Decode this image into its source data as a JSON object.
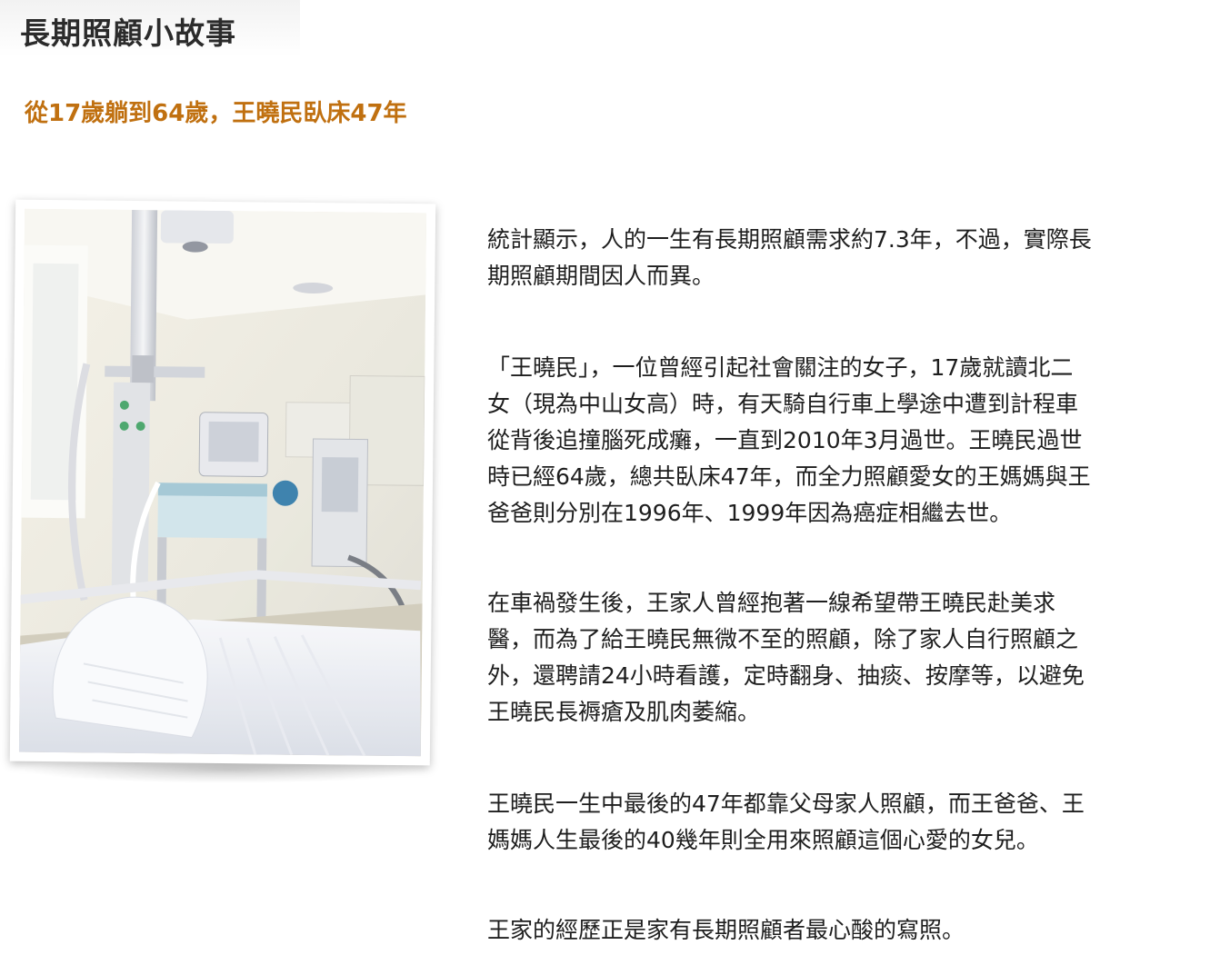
{
  "header": {
    "title": "長期照顧小故事"
  },
  "article": {
    "subtitle": "從17歲躺到64歲，王曉民臥床47年",
    "paragraphs": [
      [
        "統計顯示，人的一生有長期照顧需求約7.3年，不過，實際長",
        "期照顧期間因人而異。"
      ],
      [
        "「王曉民」，一位曾經引起社會關注的女子，17歲就讀北二",
        "女（現為中山女高）時，有天騎自行車上學途中遭到計程車",
        "從背後追撞腦死成癱，一直到2010年3月過世。王曉民過世",
        "時已經64歲，總共臥床47年，而全力照顧愛女的王媽媽與王",
        "爸爸則分別在1996年、1999年因為癌症相繼去世。"
      ],
      [
        "在車禍發生後，王家人曾經抱著一線希望帶王曉民赴美求",
        "醫，而為了給王曉民無微不至的照顧，除了家人自行照顧之",
        "外，還聘請24小時看護，定時翻身、抽痰、按摩等，以避免",
        "王曉民長褥瘡及肌肉萎縮。"
      ],
      [
        "王曉民一生中最後的47年都靠父母家人照顧，而王爸爸、王",
        "媽媽人生最後的40幾年則全用來照顧這個心愛的女兒。"
      ],
      [
        "王家的經歷正是家有長期照顧者最心酸的寫照。"
      ]
    ]
  },
  "colors": {
    "subtitle": "#c07010",
    "title": "#2b2b2b",
    "body_text": "#1e1e1e"
  },
  "image": {
    "icon": "hospital-room-photo"
  }
}
